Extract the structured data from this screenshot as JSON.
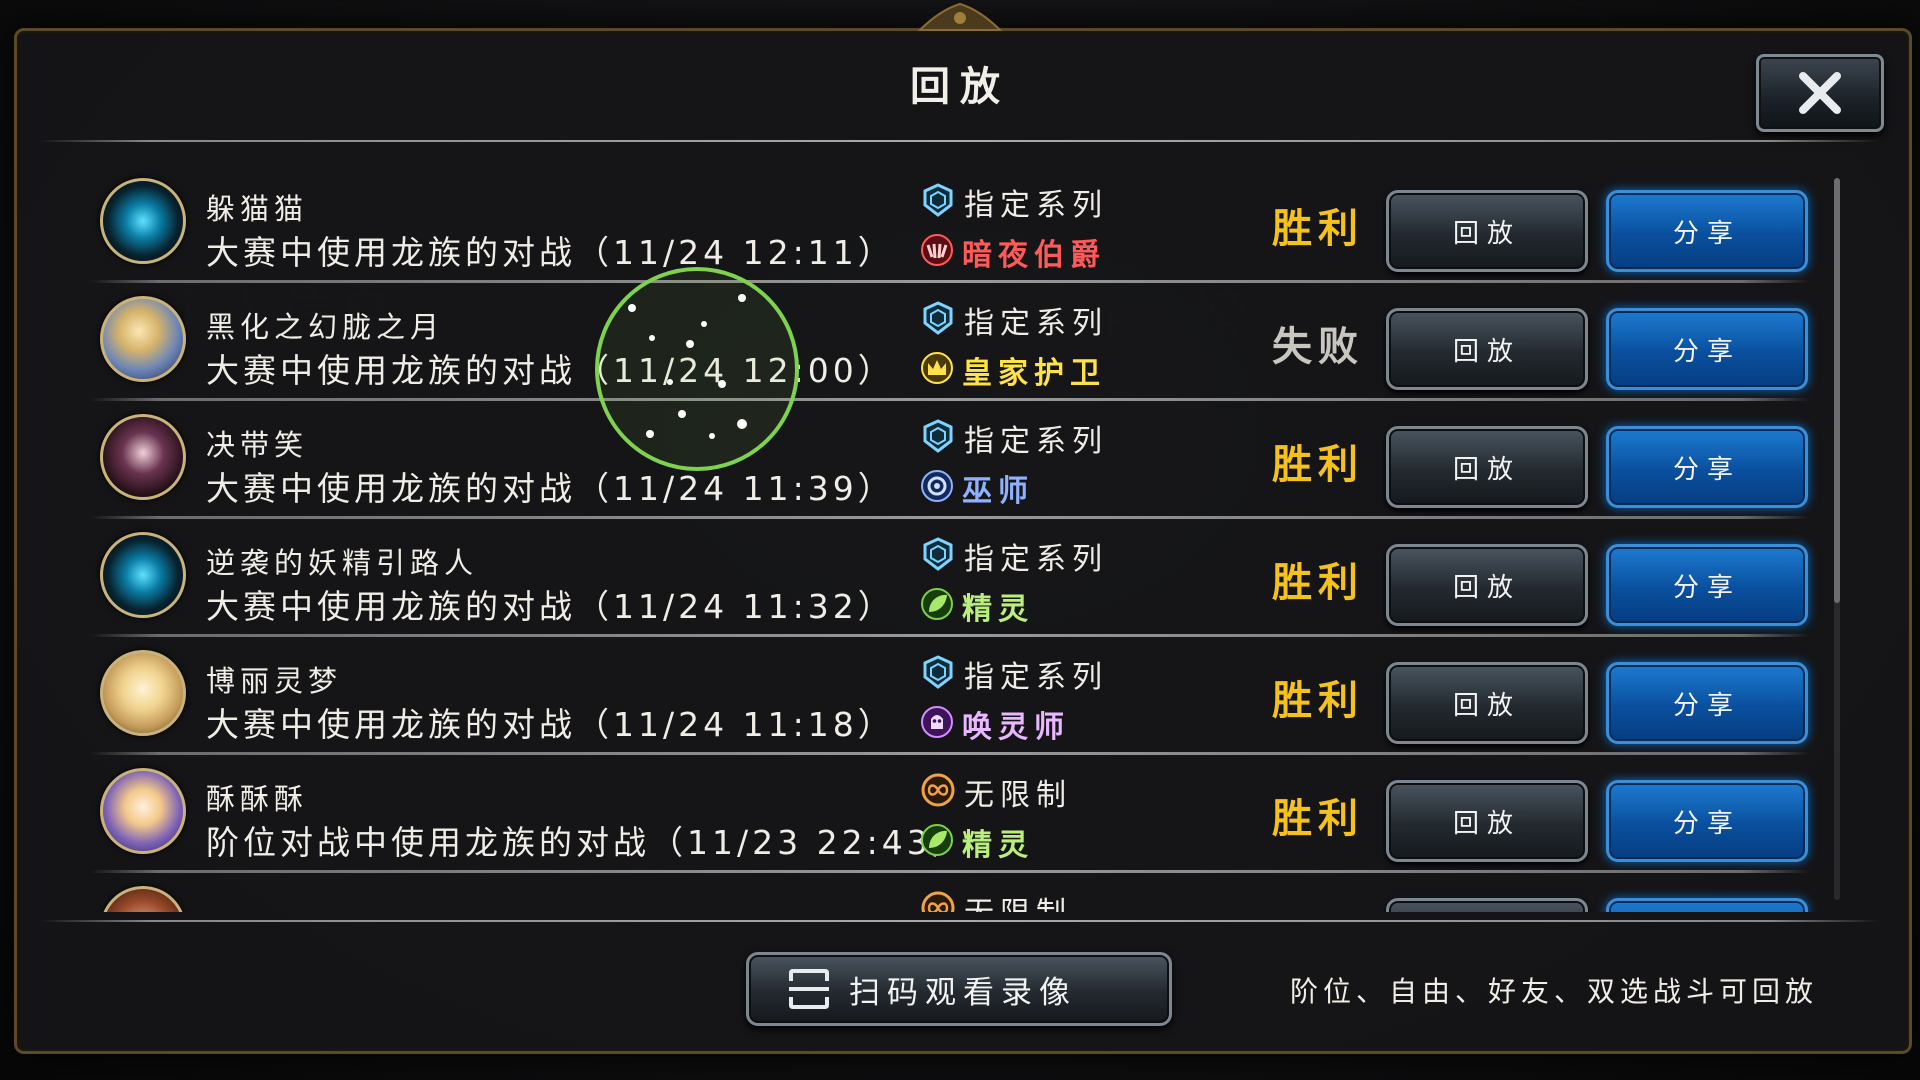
{
  "dialog": {
    "title": "回放",
    "footer_note": "阶位、自由、好友、双选战斗可回放",
    "scan_button_label": "扫码观看录像"
  },
  "colors": {
    "victory": "#f5c21b",
    "defeat": "#c9c6bf",
    "share_button": "#0d5fb4",
    "replay_button": "#2a3138",
    "class_nightcount": "#ff5a5a",
    "class_royal": "#ffe24a",
    "class_rune": "#8fb2ff",
    "class_elf": "#b9ef7a",
    "class_shadow": "#e7b7ff"
  },
  "replays": [
    {
      "player": "躲猫猫",
      "description": "大赛中使用龙族的对战（11/24 12:11）",
      "format": "指定系列",
      "format_icon": "rotation-icon",
      "opponent_class": "暗夜伯爵",
      "class_icon": "bloodcraft-icon",
      "class_color": "#ff5a5a",
      "result": "胜利",
      "result_color": "#f5c21b",
      "replay_label": "回放",
      "share_label": "分享"
    },
    {
      "player": "黑化之幻胧之月",
      "description": "大赛中使用龙族的对战（11/24 12:00）",
      "format": "指定系列",
      "format_icon": "rotation-icon",
      "opponent_class": "皇家护卫",
      "class_icon": "royal-icon",
      "class_color": "#ffe24a",
      "result": "失败",
      "result_color": "#c9c6bf",
      "replay_label": "回放",
      "share_label": "分享"
    },
    {
      "player": "决带笑",
      "description": "大赛中使用龙族的对战（11/24 11:39）",
      "format": "指定系列",
      "format_icon": "rotation-icon",
      "opponent_class": "巫师",
      "class_icon": "rune-icon",
      "class_color": "#8fb2ff",
      "result": "胜利",
      "result_color": "#f5c21b",
      "replay_label": "回放",
      "share_label": "分享"
    },
    {
      "player": "逆袭的妖精引路人",
      "description": "大赛中使用龙族的对战（11/24 11:32）",
      "format": "指定系列",
      "format_icon": "rotation-icon",
      "opponent_class": "精灵",
      "class_icon": "forest-icon",
      "class_color": "#b9ef7a",
      "result": "胜利",
      "result_color": "#f5c21b",
      "replay_label": "回放",
      "share_label": "分享"
    },
    {
      "player": "博丽灵梦",
      "description": "大赛中使用龙族的对战（11/24 11:18）",
      "format": "指定系列",
      "format_icon": "rotation-icon",
      "opponent_class": "唤灵师",
      "class_icon": "shadow-icon",
      "class_color": "#e7b7ff",
      "result": "胜利",
      "result_color": "#f5c21b",
      "replay_label": "回放",
      "share_label": "分享"
    },
    {
      "player": "酥酥酥",
      "description": "阶位对战中使用龙族的对战（11/23 22:43）",
      "format": "无限制",
      "format_icon": "unlimited-icon",
      "opponent_class": "精灵",
      "class_icon": "forest-icon",
      "class_color": "#b9ef7a",
      "result": "胜利",
      "result_color": "#f5c21b",
      "replay_label": "回放",
      "share_label": "分享"
    },
    {
      "player": "",
      "description": "",
      "format": "无限制",
      "format_icon": "unlimited-icon",
      "opponent_class": "",
      "class_icon": "",
      "class_color": "#b9ef7a",
      "result": "",
      "result_color": "#f5c21b",
      "replay_label": "",
      "share_label": ""
    }
  ]
}
